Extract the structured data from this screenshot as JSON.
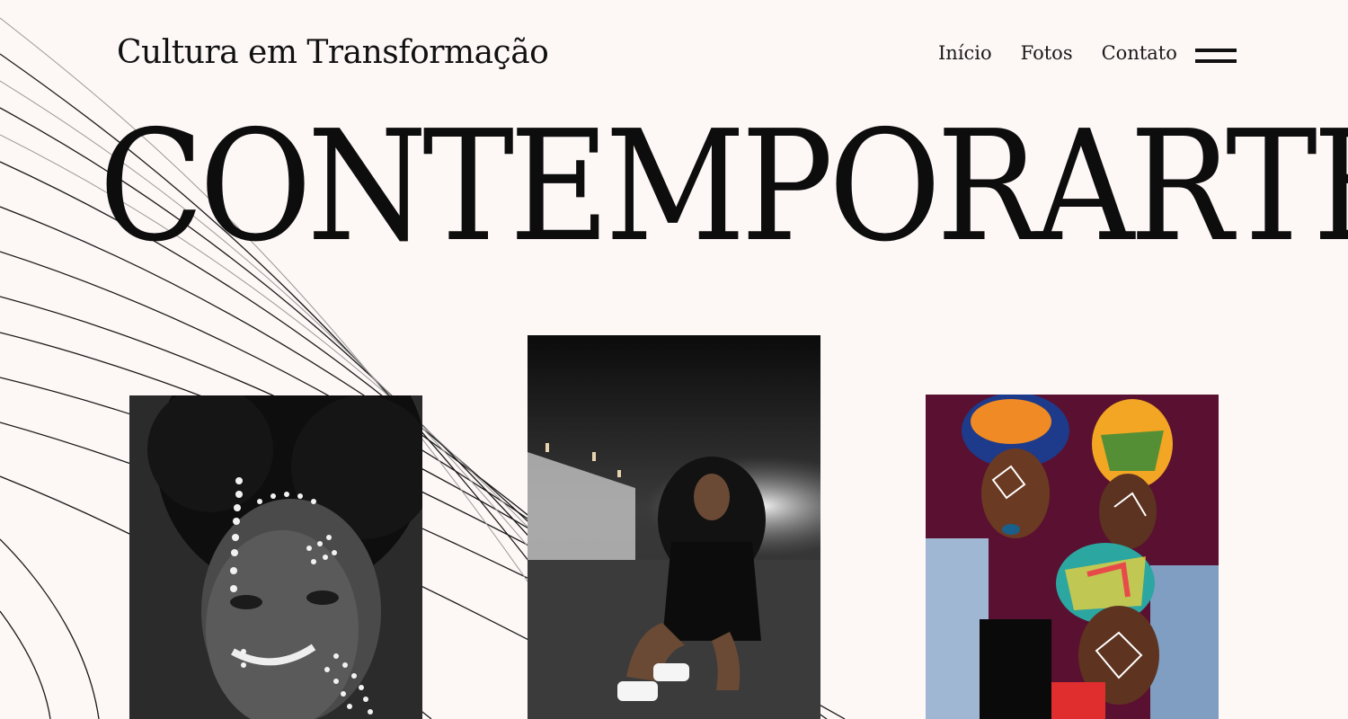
{
  "header": {
    "brand": "Cultura em Transformação",
    "nav": [
      {
        "label": "Início"
      },
      {
        "label": "Fotos"
      },
      {
        "label": "Contato"
      }
    ],
    "menu_icon": "hamburger-menu-icon"
  },
  "hero": {
    "title": "CONTEMPORARTE"
  },
  "gallery": {
    "photos": [
      {
        "name": "portrait-face-paint-bw",
        "tone": "grayscale"
      },
      {
        "name": "portrait-tunnel-crouching",
        "tone": "dark"
      },
      {
        "name": "portrait-colorful-headwraps",
        "tone": "color"
      }
    ]
  },
  "colors": {
    "background": "#fdf7f6",
    "text": "#111111",
    "accent_bg_photo3": "#5a1030"
  }
}
